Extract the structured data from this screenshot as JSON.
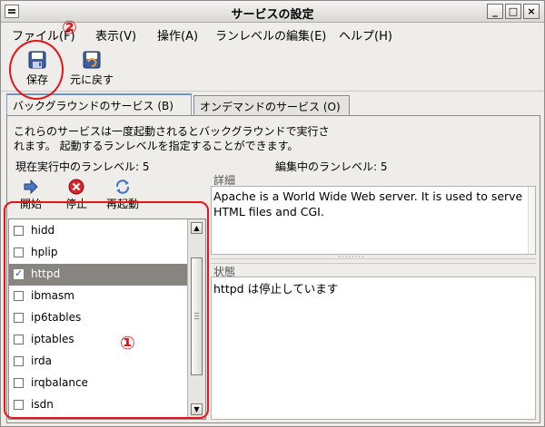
{
  "window": {
    "title": "サービスの設定"
  },
  "menu": [
    {
      "label": "ファイル(F)"
    },
    {
      "label": "表示(V)"
    },
    {
      "label": "操作(A)"
    },
    {
      "label": "ランレベルの編集(E)"
    },
    {
      "label": "ヘルプ(H)"
    }
  ],
  "toolbar": {
    "save": "保存",
    "revert": "元に戻す"
  },
  "tabs": [
    {
      "label": "バックグラウンドのサービス (B)",
      "active": true
    },
    {
      "label": "オンデマンドのサービス (O)",
      "active": false
    }
  ],
  "description": {
    "line1": "これらのサービスは一度起動されるとバックグラウンドで実行さ",
    "line2": "れます。 起動するランレベルを指定することができます。"
  },
  "runlevel": {
    "current": "現在実行中のランレベル: 5",
    "editing": "編集中のランレベル: 5"
  },
  "actions": {
    "start": "開始",
    "stop": "停止",
    "restart": "再起動"
  },
  "services": [
    {
      "name": "hidd",
      "checked": false,
      "selected": false
    },
    {
      "name": "hplip",
      "checked": false,
      "selected": false
    },
    {
      "name": "httpd",
      "checked": true,
      "selected": true
    },
    {
      "name": "ibmasm",
      "checked": false,
      "selected": false
    },
    {
      "name": "ip6tables",
      "checked": false,
      "selected": false
    },
    {
      "name": "iptables",
      "checked": false,
      "selected": false
    },
    {
      "name": "irda",
      "checked": false,
      "selected": false
    },
    {
      "name": "irqbalance",
      "checked": false,
      "selected": false
    },
    {
      "name": "isdn",
      "checked": false,
      "selected": false
    }
  ],
  "details": {
    "label": "詳細",
    "text1": "Apache is a World Wide Web server.  It is used to serve",
    "text2": "HTML files and CGI."
  },
  "status": {
    "label": "状態",
    "text": "httpd は停止しています"
  },
  "annotations": {
    "one": "①",
    "two": "②"
  },
  "colors": {
    "annotation": "#e8141a",
    "selection": "#888580",
    "tab_accent": "#6e95c8"
  }
}
